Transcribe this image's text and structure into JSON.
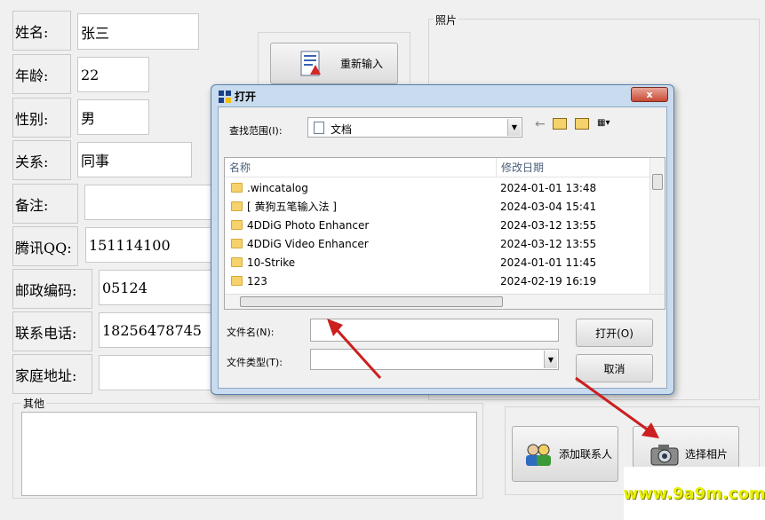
{
  "form": {
    "fields": [
      {
        "label": "姓名:",
        "value": "张三"
      },
      {
        "label": "年龄:",
        "value": "22"
      },
      {
        "label": "性别:",
        "value": "男"
      },
      {
        "label": "关系:",
        "value": "同事"
      },
      {
        "label": "备注:",
        "value": ""
      },
      {
        "label": "腾讯QQ:",
        "value": "151114100"
      },
      {
        "label": "邮政编码:",
        "value": "05124"
      },
      {
        "label": "联系电话:",
        "value": "18256478745"
      },
      {
        "label": "家庭地址:",
        "value": ""
      }
    ],
    "photo_group_title": "照片",
    "other_group_title": "其他",
    "reset_button": "重新输入",
    "add_contact_button": "添加联系人",
    "choose_photo_button": "选择相片"
  },
  "dialog": {
    "title": "打开",
    "look_in_label": "查找范围(I):",
    "look_in_value": "文档",
    "columns": [
      "名称",
      "修改日期"
    ],
    "files": [
      {
        "name": ".wincatalog",
        "date": "2024-01-01 13:48"
      },
      {
        "name": "[ 黄狗五笔输入法 ]",
        "date": "2024-03-04 15:41"
      },
      {
        "name": "4DDiG Photo Enhancer",
        "date": "2024-03-12 13:55"
      },
      {
        "name": "4DDiG Video Enhancer",
        "date": "2024-03-12 13:55"
      },
      {
        "name": "10-Strike",
        "date": "2024-01-01 11:45"
      },
      {
        "name": "123",
        "date": "2024-02-19 16:19"
      }
    ],
    "filename_label": "文件名(N):",
    "filetype_label": "文件类型(T):",
    "open_button": "打开(O)",
    "cancel_button": "取消",
    "close_glyph": "x"
  },
  "watermark": "www.9a9m.com",
  "colors": {
    "arrow": "#cc1f1f",
    "watermark": "#e8f000"
  }
}
